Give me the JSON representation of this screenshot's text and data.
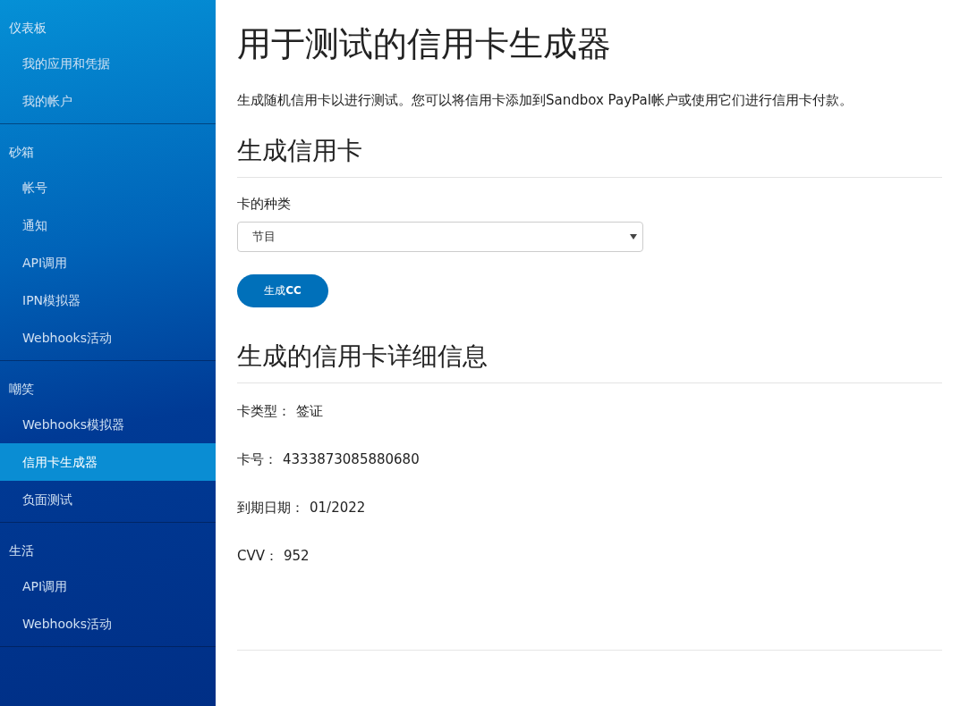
{
  "sidebar": {
    "groups": [
      {
        "heading": "仪表板",
        "items": [
          {
            "label": "我的应用和凭据",
            "selected": false
          },
          {
            "label": "我的帐户",
            "selected": false
          }
        ]
      },
      {
        "heading": "砂箱",
        "items": [
          {
            "label": "帐号",
            "selected": false
          },
          {
            "label": "通知",
            "selected": false
          },
          {
            "label": "API调用",
            "selected": false
          },
          {
            "label": "IPN模拟器",
            "selected": false
          },
          {
            "label": "Webhooks活动",
            "selected": false
          }
        ]
      },
      {
        "heading": "嘲笑",
        "items": [
          {
            "label": "Webhooks模拟器",
            "selected": false
          },
          {
            "label": "信用卡生成器",
            "selected": true
          },
          {
            "label": "负面测试",
            "selected": false
          }
        ]
      },
      {
        "heading": "生活",
        "items": [
          {
            "label": "API调用",
            "selected": false
          },
          {
            "label": "Webhooks活动",
            "selected": false
          }
        ]
      }
    ]
  },
  "page": {
    "title": "用于测试的信用卡生成器",
    "intro": "生成随机信用卡以进行测试。您可以将信用卡添加到Sandbox PayPal帐户或使用它们进行信用卡付款。",
    "generate_section": {
      "heading": "生成信用卡",
      "card_type_label": "卡的种类",
      "card_type_value": "节目",
      "button": "生成**CC**"
    },
    "details_section": {
      "heading": "生成的信用卡详细信息",
      "rows": [
        {
          "label": "卡类型：",
          "value": "签证"
        },
        {
          "label": "卡号：",
          "value": "4333873085880680"
        },
        {
          "label": "到期日期：",
          "value": "01/2022"
        },
        {
          "label": "CVV：",
          "value": "952"
        }
      ]
    }
  }
}
